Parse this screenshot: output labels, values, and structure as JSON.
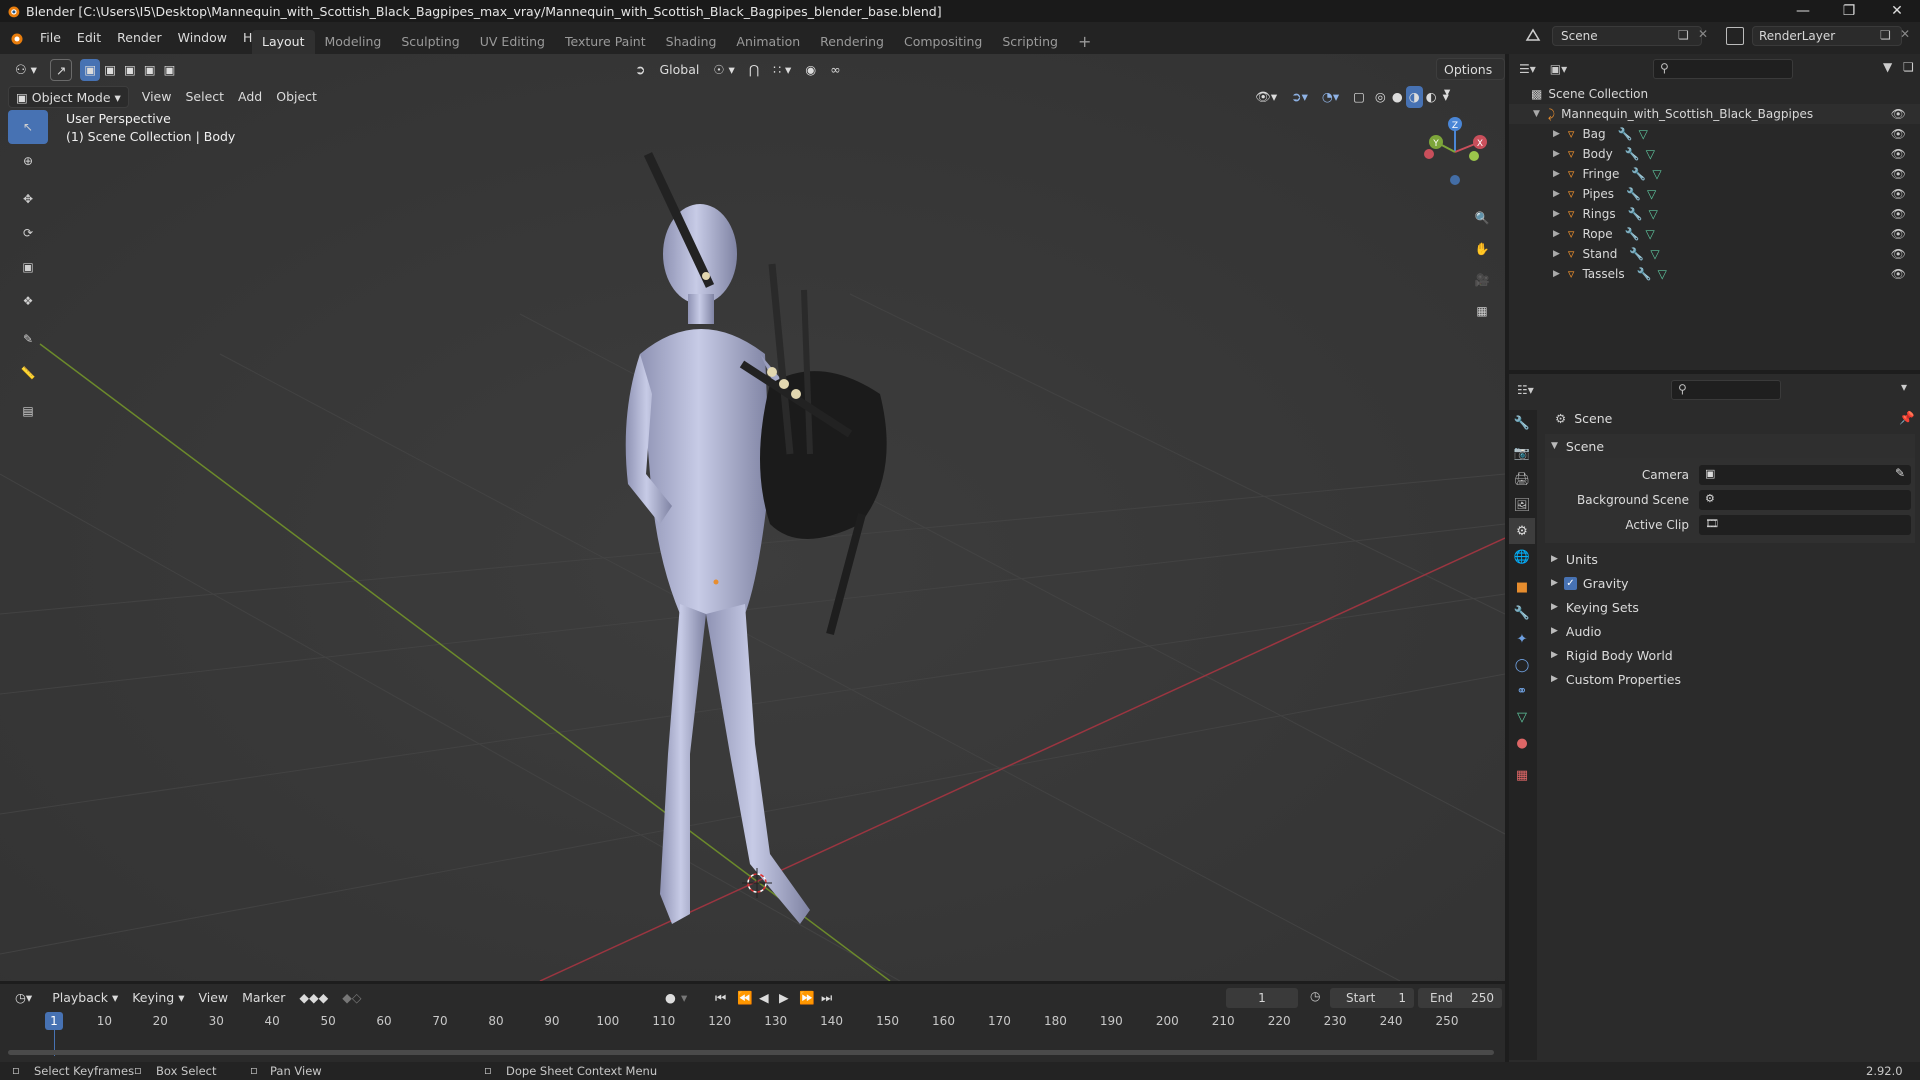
{
  "window": {
    "title": "Blender [C:\\Users\\I5\\Desktop\\Mannequin_with_Scottish_Black_Bagpipes_max_vray/Mannequin_with_Scottish_Black_Bagpipes_blender_base.blend]"
  },
  "menu": [
    "File",
    "Edit",
    "Render",
    "Window",
    "Help"
  ],
  "workspaces": [
    "Layout",
    "Modeling",
    "Sculpting",
    "UV Editing",
    "Texture Paint",
    "Shading",
    "Animation",
    "Rendering",
    "Compositing",
    "Scripting"
  ],
  "topbar": {
    "scene": "Scene",
    "view_layer": "RenderLayer"
  },
  "viewport": {
    "mode": "Object Mode",
    "menus": [
      "View",
      "Select",
      "Add",
      "Object"
    ],
    "transform_orientation": "Global",
    "options_label": "Options",
    "overlay_line1": "User Perspective",
    "overlay_line2": "(1) Scene Collection | Body",
    "gizmo": {
      "x": "X",
      "y": "Y",
      "z": "Z"
    }
  },
  "outliner": {
    "root": "Scene Collection",
    "collection": "Mannequin_with_Scottish_Black_Bagpipes",
    "objects": [
      "Bag",
      "Body",
      "Fringe",
      "Pipes",
      "Rings",
      "Rope",
      "Stand",
      "Tassels"
    ]
  },
  "properties": {
    "context": "Scene",
    "panel": "Scene",
    "fields": [
      {
        "label": "Camera",
        "value": ""
      },
      {
        "label": "Background Scene",
        "value": ""
      },
      {
        "label": "Active Clip",
        "value": ""
      }
    ],
    "subpanels": [
      "Units",
      "Gravity",
      "Keying Sets",
      "Audio",
      "Rigid Body World",
      "Custom Properties"
    ],
    "gravity_checked": true
  },
  "timeline": {
    "menus": [
      "Playback",
      "Keying",
      "View",
      "Marker"
    ],
    "current_frame": "1",
    "start_label": "Start",
    "start": "1",
    "end_label": "End",
    "end": "250",
    "ruler": [
      "1",
      "10",
      "20",
      "30",
      "40",
      "50",
      "60",
      "70",
      "80",
      "90",
      "100",
      "110",
      "120",
      "130",
      "140",
      "150",
      "160",
      "170",
      "180",
      "190",
      "200",
      "210",
      "220",
      "230",
      "240",
      "250"
    ]
  },
  "status": {
    "items": [
      "Select Keyframes",
      "Box Select",
      "Pan View",
      "Dope Sheet Context Menu"
    ],
    "version": "2.92.0"
  },
  "colors": {
    "accent": "#4772b3",
    "x_axis": "#c94f5b",
    "y_axis": "#7da53a",
    "z_axis": "#4a86d6",
    "object": "#e78d2e",
    "mesh": "#5fc69e"
  }
}
